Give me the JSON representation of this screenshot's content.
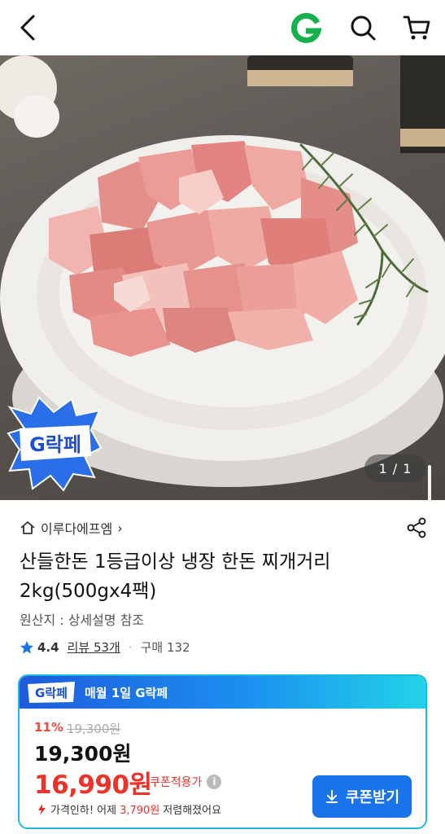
{
  "topbar": {
    "back_icon": "chevron-left-icon",
    "logo_letter": "G",
    "search_icon": "search-icon",
    "cart_icon": "cart-icon",
    "brand_color": "#16b04c"
  },
  "gallery": {
    "counter": "1 / 1",
    "badge_text": "G락페"
  },
  "product": {
    "seller": "이루다에프엠",
    "seller_chevron": "›",
    "title": "산들한돈 1등급이상 냉장 한돈 찌개거리 2kg(500gx4팩)",
    "origin": "원산지 : 상세설명 참조",
    "rating": "4.4",
    "review": "리뷰 53개",
    "purchase": "구매 132"
  },
  "promo": {
    "badge_text": "G락페",
    "header": "매월 1일 G락페",
    "discount_rate": "11%",
    "original_price": "19,300원",
    "price": "19,300원",
    "coupon_price": "16,990원",
    "coupon_label": "쿠폰적용가",
    "info_icon": "i",
    "drop_prefix": "가격인하! 어제",
    "drop_amount": "3,790원",
    "drop_suffix": "저렴해졌어요",
    "coupon_button": "쿠폰받기",
    "accent": "#1a73e8",
    "sale_color": "#f0312a"
  }
}
